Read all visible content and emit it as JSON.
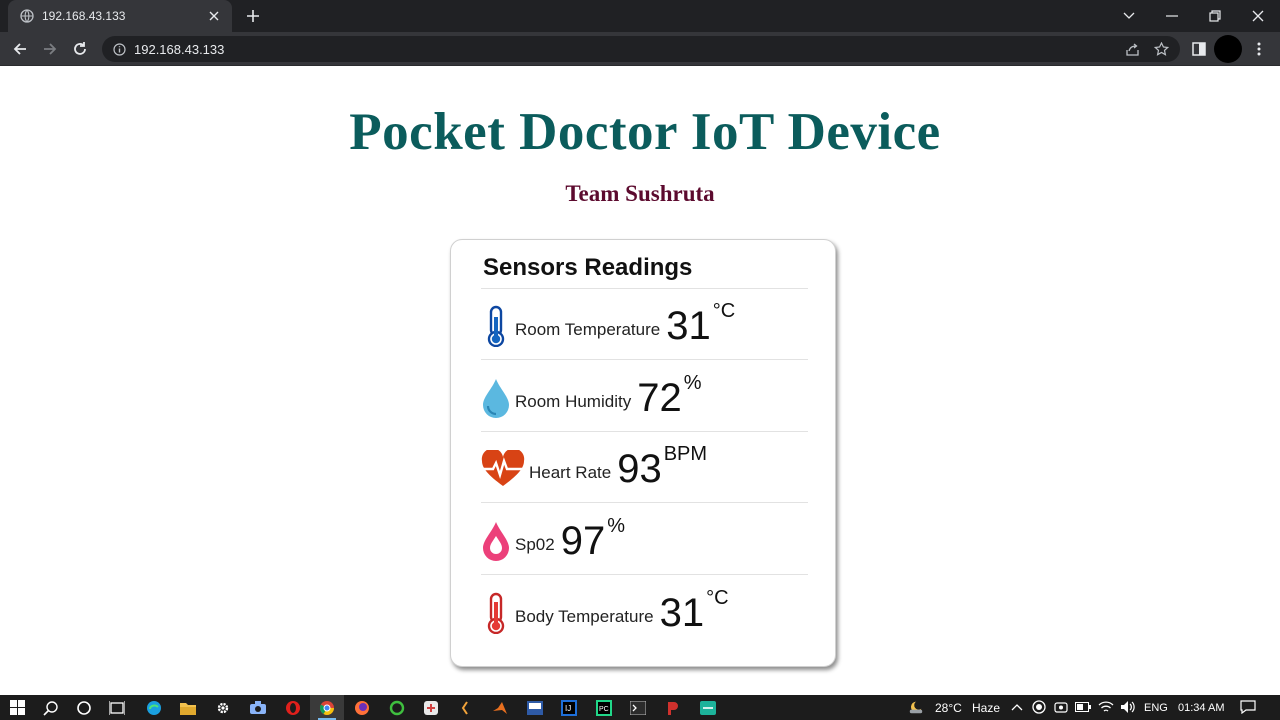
{
  "browser": {
    "tab_title": "192.168.43.133",
    "url": "192.168.43.133"
  },
  "page": {
    "title": "Pocket Doctor IoT Device",
    "subtitle": "Team Sushruta"
  },
  "card": {
    "title": "Sensors Readings",
    "readings": [
      {
        "label": "Room Temperature",
        "value": "31",
        "unit": "°C",
        "icon": "thermometer-icon"
      },
      {
        "label": "Room Humidity",
        "value": "72",
        "unit": "%",
        "icon": "water-drop-icon"
      },
      {
        "label": "Heart Rate",
        "value": "93",
        "unit": "BPM",
        "icon": "heart-rate-icon"
      },
      {
        "label": "Sp02",
        "value": "97",
        "unit": "%",
        "icon": "blood-drop-icon"
      },
      {
        "label": "Body Temperature",
        "value": "31",
        "unit": "°C",
        "icon": "body-thermometer-icon"
      }
    ]
  },
  "taskbar": {
    "weather": "28°C",
    "weather_desc": "Haze",
    "language": "ENG",
    "time": "01:34 AM"
  },
  "colors": {
    "title": "#0b5c5c",
    "subtitle": "#5c0a2e",
    "chrome_dark": "#202124",
    "chrome_toolbar": "#35363a"
  }
}
